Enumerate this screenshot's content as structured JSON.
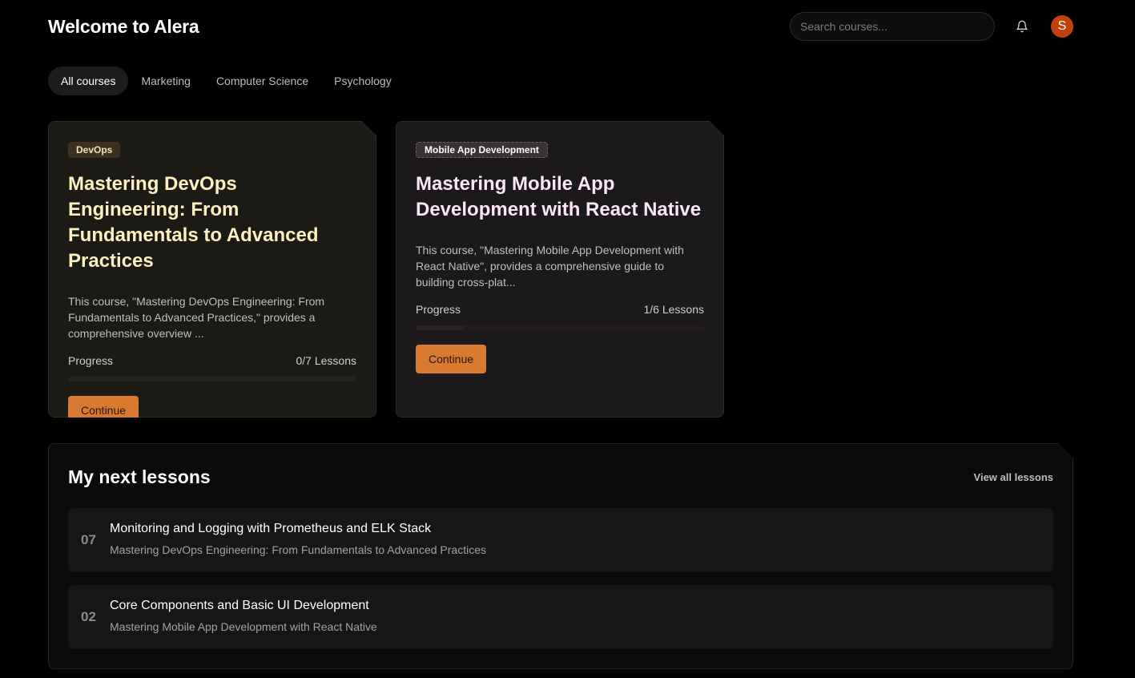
{
  "header": {
    "title": "Welcome to Alera",
    "search_placeholder": "Search courses...",
    "avatar_initial": "S"
  },
  "tabs": [
    {
      "label": "All courses",
      "active": true
    },
    {
      "label": "Marketing",
      "active": false
    },
    {
      "label": "Computer Science",
      "active": false
    },
    {
      "label": "Psychology",
      "active": false
    }
  ],
  "courses": [
    {
      "category": "DevOps",
      "title": "Mastering DevOps Engineering: From Fundamentals to Advanced Practices",
      "description": "This course, \"Mastering DevOps Engineering: From Fundamentals to Advanced Practices,\" provides a comprehensive overview ...",
      "progress_label": "Progress",
      "lessons_label": "0/7 Lessons",
      "progress_fraction": 0,
      "button_label": "Continue"
    },
    {
      "category": "Mobile App Development",
      "title": "Mastering Mobile App Development with React Native",
      "description": "This course, \"Mastering Mobile App Development with React Native\", provides a comprehensive guide to building cross-plat...",
      "progress_label": "Progress",
      "lessons_label": "1/6 Lessons",
      "progress_fraction": 0.1667,
      "button_label": "Continue"
    }
  ],
  "next_lessons": {
    "title": "My next lessons",
    "view_all_label": "View all lessons",
    "items": [
      {
        "number": "07",
        "title": "Monitoring and Logging with Prometheus and ELK Stack",
        "course": "Mastering DevOps Engineering: From Fundamentals to Advanced Practices"
      },
      {
        "number": "02",
        "title": "Core Components and Basic UI Development",
        "course": "Mastering Mobile App Development with React Native"
      }
    ]
  },
  "colors": {
    "accent": "#d97a31",
    "avatar": "#c2410c"
  }
}
